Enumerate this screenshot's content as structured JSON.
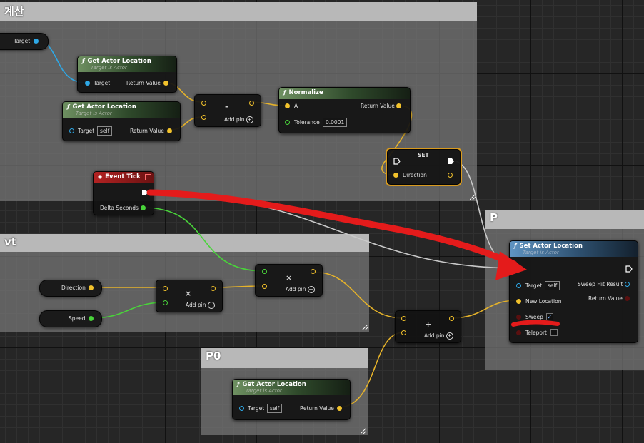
{
  "comments": {
    "top": {
      "title": "계산"
    },
    "middle": {
      "title": "vt"
    },
    "right": {
      "title": "P"
    },
    "bottom": {
      "title": "P0"
    }
  },
  "nodes": {
    "target_var": {
      "label": "Target"
    },
    "get_actor_location_1": {
      "title": "Get Actor Location",
      "subtitle": "Target is Actor",
      "in_label": "Target",
      "out_label": "Return Value"
    },
    "get_actor_location_2": {
      "title": "Get Actor Location",
      "subtitle": "Target is Actor",
      "in_label": "Target",
      "in_value": "self",
      "out_label": "Return Value"
    },
    "subtract": {
      "op": "-",
      "add_pin": "Add pin"
    },
    "normalize": {
      "title": "Normalize",
      "in_label": "A",
      "tolerance_label": "Tolerance",
      "tolerance_value": "0.0001",
      "out_label": "Return Value"
    },
    "set": {
      "title": "SET",
      "label": "Direction"
    },
    "event_tick": {
      "title": "Event Tick",
      "delta_label": "Delta Seconds"
    },
    "direction_var": {
      "label": "Direction"
    },
    "speed_var": {
      "label": "Speed"
    },
    "multiply_1": {
      "op": "×",
      "add_pin": "Add pin"
    },
    "multiply_2": {
      "op": "×",
      "add_pin": "Add pin"
    },
    "add": {
      "op": "+",
      "add_pin": "Add pin"
    },
    "set_actor_location": {
      "title": "Set Actor Location",
      "subtitle": "Target is Actor",
      "target_label": "Target",
      "target_value": "self",
      "new_location_label": "New Location",
      "sweep_label": "Sweep",
      "sweep_checked": "✓",
      "teleport_label": "Teleport",
      "sweep_hit_label": "Sweep Hit Result",
      "return_label": "Return Value"
    },
    "get_actor_location_3": {
      "title": "Get Actor Location",
      "subtitle": "Target is Actor",
      "in_label": "Target",
      "in_value": "self",
      "out_label": "Return Value"
    }
  },
  "colors": {
    "vector_wire": "#e6b32a",
    "object_wire": "#2ea8e6",
    "float_wire": "#49d43a",
    "exec_wire": "#c9c9c9",
    "annotation": "#e41b1b"
  },
  "icons": {
    "function": "function-icon",
    "event": "event-diamond-icon",
    "exec": "exec-arrow-icon",
    "add_pin": "plus-circle-icon"
  }
}
